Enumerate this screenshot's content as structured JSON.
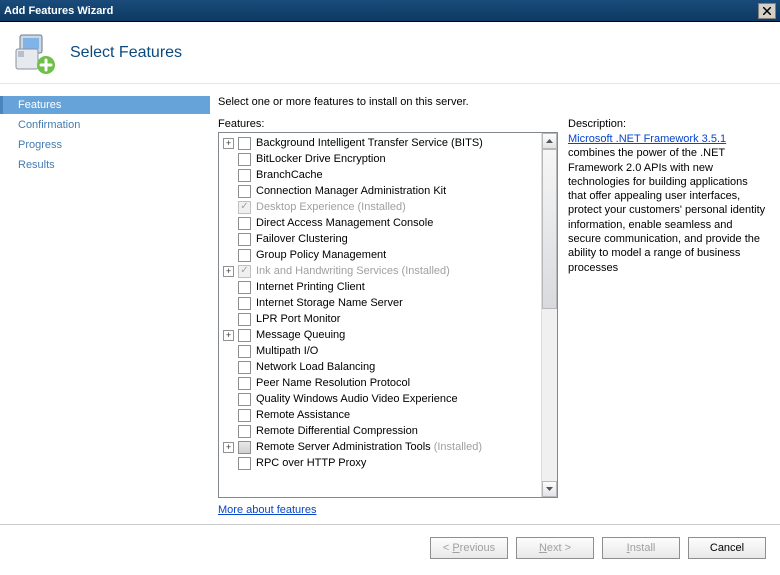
{
  "window": {
    "title": "Add Features Wizard"
  },
  "header": {
    "page_title": "Select Features"
  },
  "sidebar": {
    "items": [
      {
        "label": "Features",
        "active": true
      },
      {
        "label": "Confirmation",
        "active": false
      },
      {
        "label": "Progress",
        "active": false
      },
      {
        "label": "Results",
        "active": false
      }
    ]
  },
  "main": {
    "instruction": "Select one or more features to install on this server.",
    "features_label": "Features:",
    "description_label": "Description:",
    "more_link": "More about features",
    "features": [
      {
        "expand": "+",
        "checked": false,
        "disabled": false,
        "label": "Background Intelligent Transfer Service (BITS)",
        "installed": false
      },
      {
        "expand": "",
        "checked": false,
        "disabled": false,
        "label": "BitLocker Drive Encryption",
        "installed": false
      },
      {
        "expand": "",
        "checked": false,
        "disabled": false,
        "label": "BranchCache",
        "installed": false
      },
      {
        "expand": "",
        "checked": false,
        "disabled": false,
        "label": "Connection Manager Administration Kit",
        "installed": false
      },
      {
        "expand": "",
        "checked": true,
        "disabled": true,
        "label": "Desktop Experience",
        "installed": true
      },
      {
        "expand": "",
        "checked": false,
        "disabled": false,
        "label": "Direct Access Management Console",
        "installed": false
      },
      {
        "expand": "",
        "checked": false,
        "disabled": false,
        "label": "Failover Clustering",
        "installed": false
      },
      {
        "expand": "",
        "checked": false,
        "disabled": false,
        "label": "Group Policy Management",
        "installed": false
      },
      {
        "expand": "+",
        "checked": true,
        "disabled": true,
        "label": "Ink and Handwriting Services",
        "installed": true
      },
      {
        "expand": "",
        "checked": false,
        "disabled": false,
        "label": "Internet Printing Client",
        "installed": false
      },
      {
        "expand": "",
        "checked": false,
        "disabled": false,
        "label": "Internet Storage Name Server",
        "installed": false
      },
      {
        "expand": "",
        "checked": false,
        "disabled": false,
        "label": "LPR Port Monitor",
        "installed": false
      },
      {
        "expand": "+",
        "checked": false,
        "disabled": false,
        "label": "Message Queuing",
        "installed": false
      },
      {
        "expand": "",
        "checked": false,
        "disabled": false,
        "label": "Multipath I/O",
        "installed": false
      },
      {
        "expand": "",
        "checked": false,
        "disabled": false,
        "label": "Network Load Balancing",
        "installed": false
      },
      {
        "expand": "",
        "checked": false,
        "disabled": false,
        "label": "Peer Name Resolution Protocol",
        "installed": false
      },
      {
        "expand": "",
        "checked": false,
        "disabled": false,
        "label": "Quality Windows Audio Video Experience",
        "installed": false
      },
      {
        "expand": "",
        "checked": false,
        "disabled": false,
        "label": "Remote Assistance",
        "installed": false
      },
      {
        "expand": "",
        "checked": false,
        "disabled": false,
        "label": "Remote Differential Compression",
        "installed": false
      },
      {
        "expand": "+",
        "checked": false,
        "disabled": false,
        "label": "Remote Server Administration Tools",
        "installed": true,
        "partial": true
      },
      {
        "expand": "",
        "checked": false,
        "disabled": false,
        "label": "RPC over HTTP Proxy",
        "installed": false
      }
    ],
    "description": {
      "link_text": "Microsoft .NET Framework 3.5.1",
      "body": "combines the power of the .NET Framework 2.0 APIs with new technologies for building applications that offer appealing user interfaces, protect your customers' personal identity information, enable seamless and secure communication, and provide the ability to model a range of business processes"
    }
  },
  "buttons": {
    "previous": "< Previous",
    "next": "Next >",
    "install": "Install",
    "cancel": "Cancel"
  },
  "installed_suffix": "  (Installed)"
}
